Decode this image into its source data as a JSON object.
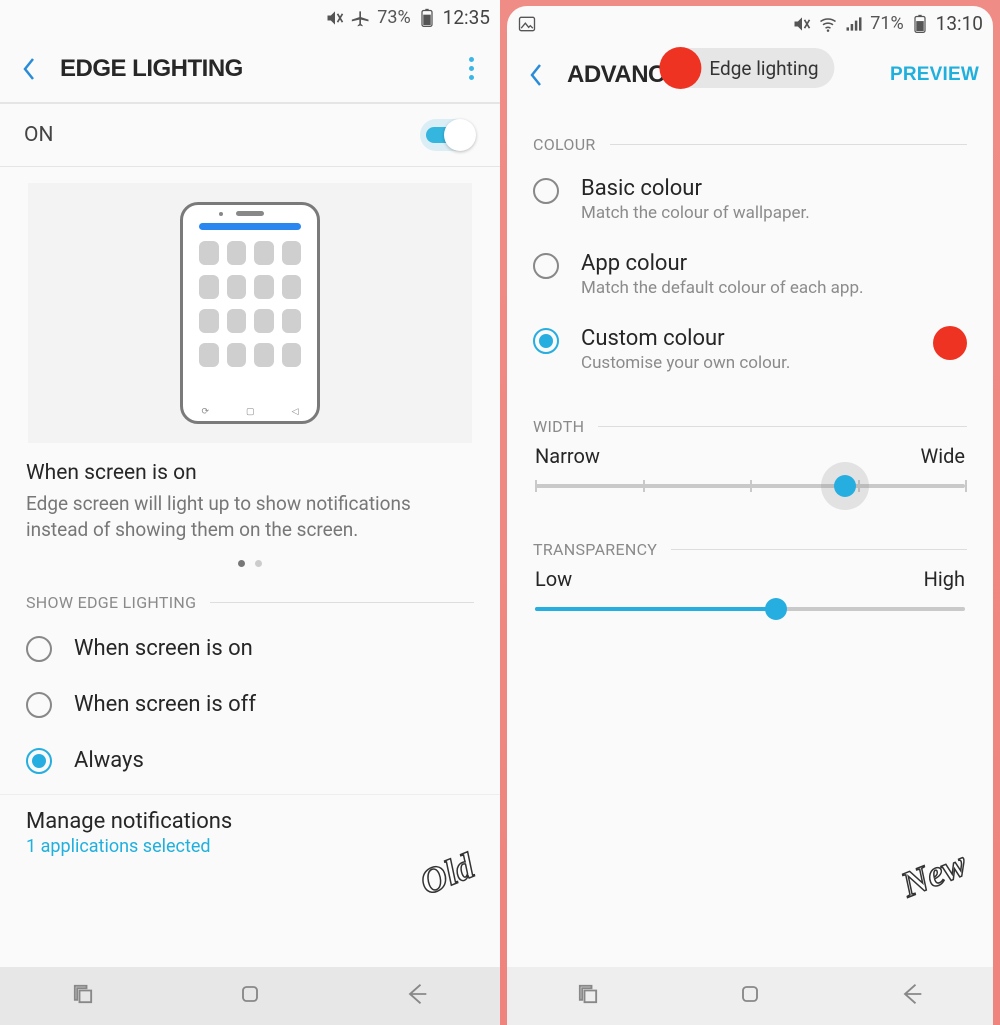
{
  "left": {
    "status": {
      "battery_pct": "73%",
      "time": "12:35"
    },
    "header": {
      "title": "EDGE LIGHTING"
    },
    "on_row": {
      "label": "ON",
      "enabled": true
    },
    "caption": {
      "heading": "When screen is on",
      "body": "Edge screen will light up to show notifications instead of showing them on the screen."
    },
    "section_show": "SHOW EDGE LIGHTING",
    "radios": [
      {
        "label": "When screen is on",
        "selected": false
      },
      {
        "label": "When screen is off",
        "selected": false
      },
      {
        "label": "Always",
        "selected": true
      }
    ],
    "manage": {
      "title": "Manage notifications",
      "sub": "1 applications selected"
    },
    "watermark": "Old"
  },
  "right": {
    "status": {
      "battery_pct": "71%",
      "time": "13:10"
    },
    "header": {
      "title": "ADVANCED",
      "preview": "PREVIEW"
    },
    "pill": "Edge lighting",
    "section_colour": "COLOUR",
    "colour_opts": [
      {
        "title": "Basic colour",
        "sub": "Match the colour of wallpaper.",
        "selected": false
      },
      {
        "title": "App colour",
        "sub": "Match the default colour of each app.",
        "selected": false
      },
      {
        "title": "Custom colour",
        "sub": "Customise your own colour.",
        "selected": true,
        "swatch": "#ef3323"
      }
    ],
    "section_width": "WIDTH",
    "width_slider": {
      "left": "Narrow",
      "right": "Wide",
      "value_pct": 72,
      "ticks": 5
    },
    "section_transparency": "TRANSPARENCY",
    "trans_slider": {
      "left": "Low",
      "right": "High",
      "value_pct": 56
    },
    "watermark": "New"
  }
}
